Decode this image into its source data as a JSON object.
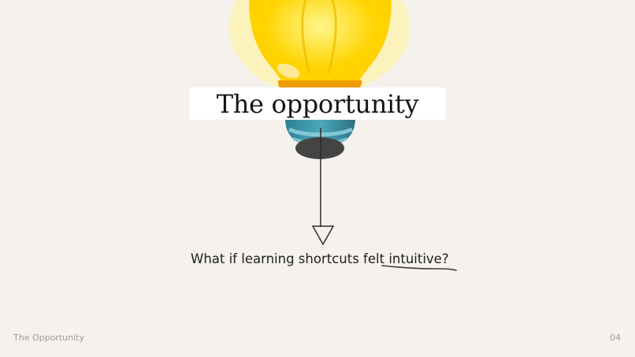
{
  "slide": {
    "title": "The opportunity",
    "question_prefix": "What if learning shortcuts felt",
    "question_emphasis": "intuitive?",
    "footer_label": "The Opportunity",
    "page_number": "04"
  },
  "colors": {
    "background": "#f5f2ee",
    "bulb": "#ffd400",
    "bulb_glow": "#ffef7c",
    "socket": "#3f8fa1",
    "text": "#151515"
  },
  "icons": {
    "bulb": "light-bulb-icon",
    "arrow": "down-arrow-icon"
  }
}
